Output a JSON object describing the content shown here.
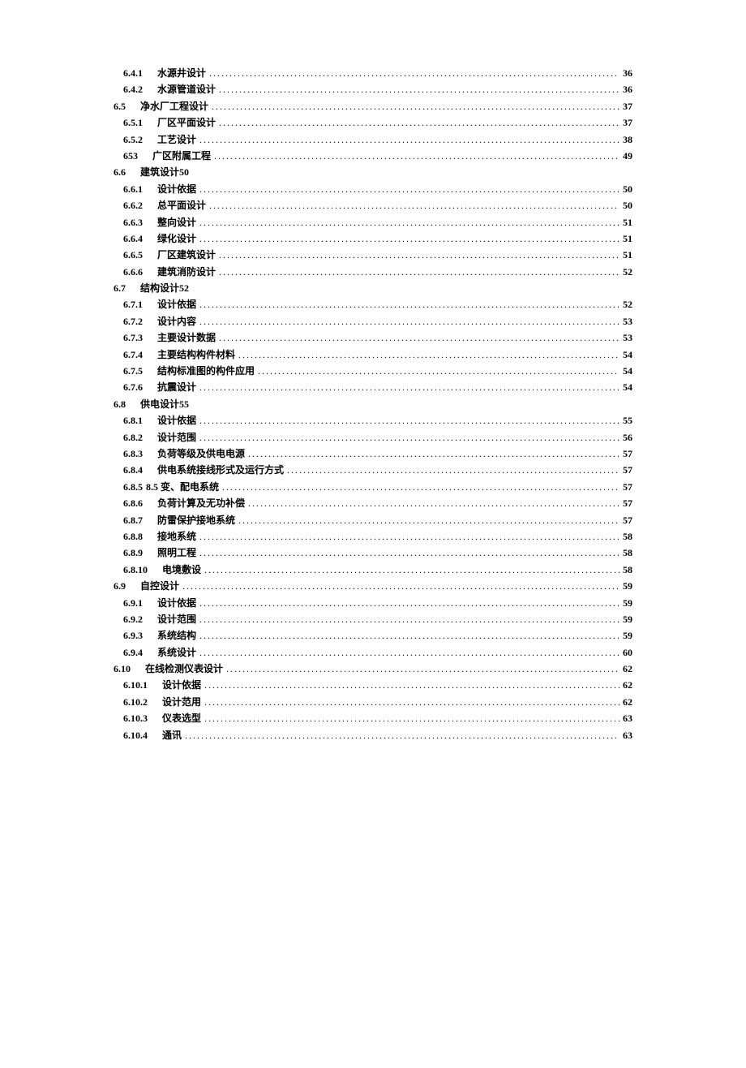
{
  "toc": [
    {
      "num": "6.4.1",
      "title": "水源井设计",
      "page": "36",
      "indent": 2,
      "dots": true
    },
    {
      "num": "6.4.2",
      "title": "水源管道设计",
      "page": "36",
      "indent": 2,
      "dots": true
    },
    {
      "num": "6.5",
      "title": "净水厂工程设计",
      "page": "37",
      "indent": 1,
      "dots": true
    },
    {
      "num": "6.5.1",
      "title": "厂区平面设计",
      "page": "37",
      "indent": 2,
      "dots": true
    },
    {
      "num": "6.5.2",
      "title": "工艺设计",
      "page": "38",
      "indent": 2,
      "dots": true
    },
    {
      "num": "653",
      "title": "广区附属工程",
      "page": "49",
      "indent": 2,
      "dots": true
    },
    {
      "num": "6.6",
      "title": "建筑设计50",
      "page": "",
      "indent": 1,
      "dots": false
    },
    {
      "num": "6.6.1",
      "title": "设计依据",
      "page": "50",
      "indent": 2,
      "dots": true
    },
    {
      "num": "6.6.2",
      "title": "总平面设计",
      "page": "50",
      "indent": 2,
      "dots": true
    },
    {
      "num": "6.6.3",
      "title": "整向设计",
      "page": "51",
      "indent": 2,
      "dots": true
    },
    {
      "num": "6.6.4",
      "title": "绿化设计",
      "page": "51",
      "indent": 2,
      "dots": true
    },
    {
      "num": "6.6.5",
      "title": "厂区建筑设计",
      "page": "51",
      "indent": 2,
      "dots": true
    },
    {
      "num": "6.6.6",
      "title": "建筑消防设计",
      "page": "52",
      "indent": 2,
      "dots": true
    },
    {
      "num": "6.7",
      "title": "结构设计52",
      "page": "",
      "indent": 1,
      "dots": false
    },
    {
      "num": "6.7.1",
      "title": "设计依据",
      "page": "52",
      "indent": 2,
      "dots": true
    },
    {
      "num": "6.7.2",
      "title": "设计内容",
      "page": "53",
      "indent": 2,
      "dots": true
    },
    {
      "num": "6.7.3",
      "title": "主要设计数据",
      "page": "53",
      "indent": 2,
      "dots": true
    },
    {
      "num": "6.7.4",
      "title": "主要结构构件材料",
      "page": "54",
      "indent": 2,
      "dots": true
    },
    {
      "num": "6.7.5",
      "title": "结构标准图的构件应用",
      "page": "54",
      "indent": 2,
      "dots": true
    },
    {
      "num": "6.7.6",
      "title": "抗震设计",
      "page": "54",
      "indent": 2,
      "dots": true
    },
    {
      "num": "6.8",
      "title": "供电设计55",
      "page": "",
      "indent": 1,
      "dots": false
    },
    {
      "num": "6.8.1",
      "title": "设计依据",
      "page": "55",
      "indent": 2,
      "dots": true
    },
    {
      "num": "6.8.2",
      "title": "设计范围",
      "page": "56",
      "indent": 2,
      "dots": true
    },
    {
      "num": "6.8.3",
      "title": "负荷等级及供电电源",
      "page": "57",
      "indent": 2,
      "dots": true
    },
    {
      "num": "6.8.4",
      "title": "供电系统接线形式及运行方式",
      "page": "57",
      "indent": 2,
      "dots": true
    },
    {
      "num": "6.8.5",
      "title": "8.5 变、配电系统",
      "page": "57",
      "indent": 2,
      "dots": true,
      "tight": true
    },
    {
      "num": "6.8.6",
      "title": "负荷计算及无功补偿",
      "page": "57",
      "indent": 2,
      "dots": true
    },
    {
      "num": "6.8.7",
      "title": "防雷保护接地系统",
      "page": "57",
      "indent": 2,
      "dots": true
    },
    {
      "num": "6.8.8",
      "title": "接地系统",
      "page": "58",
      "indent": 2,
      "dots": true
    },
    {
      "num": "6.8.9",
      "title": "照明工程",
      "page": "58",
      "indent": 2,
      "dots": true
    },
    {
      "num": "6.8.10",
      "title": "电境敷设",
      "page": "58",
      "indent": 2,
      "dots": true
    },
    {
      "num": "6.9",
      "title": "自控设计",
      "page": "59",
      "indent": 1,
      "dots": true
    },
    {
      "num": "6.9.1",
      "title": "设计依据",
      "page": "59",
      "indent": 2,
      "dots": true
    },
    {
      "num": "6.9.2",
      "title": "设计范围",
      "page": "59",
      "indent": 2,
      "dots": true
    },
    {
      "num": "6.9.3",
      "title": "系统结构",
      "page": "59",
      "indent": 2,
      "dots": true
    },
    {
      "num": "6.9.4",
      "title": "系统设计",
      "page": "60",
      "indent": 2,
      "dots": true
    },
    {
      "num": "6.10",
      "title": "在线检测仪表设计",
      "page": "62",
      "indent": 1,
      "dots": true
    },
    {
      "num": "6.10.1",
      "title": "设计依据",
      "page": "62",
      "indent": 2,
      "dots": true
    },
    {
      "num": "6.10.2",
      "title": "设计范用",
      "page": "62",
      "indent": 2,
      "dots": true
    },
    {
      "num": "6.10.3",
      "title": "仪表选型",
      "page": "63",
      "indent": 2,
      "dots": true
    },
    {
      "num": "6.10.4",
      "title": "通讯",
      "page": "63",
      "indent": 2,
      "dots": true
    }
  ]
}
